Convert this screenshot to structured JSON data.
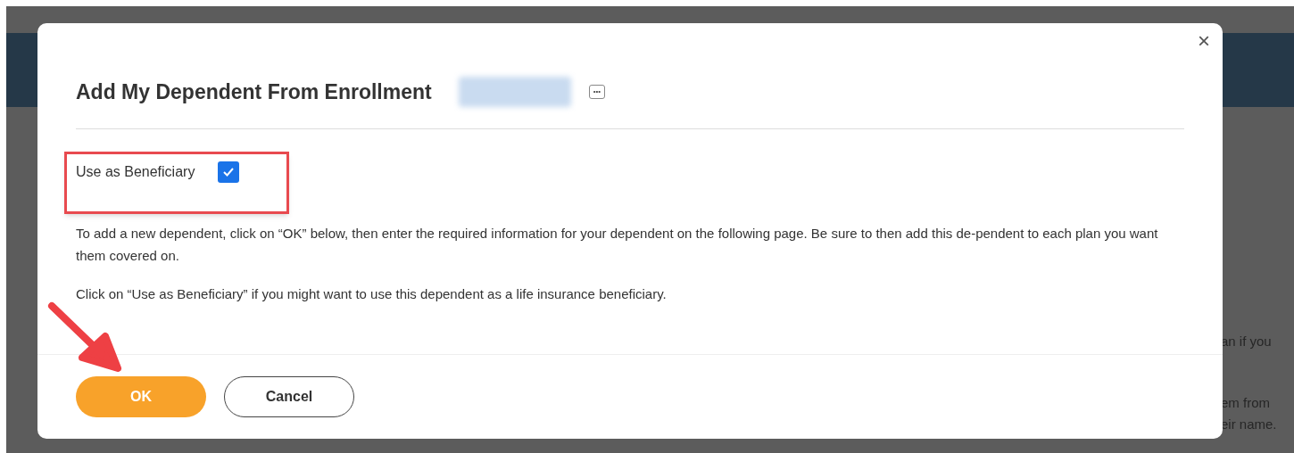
{
  "background": {
    "fragments": [
      "an if you",
      "em from",
      "eir name."
    ]
  },
  "dialog": {
    "title": "Add My Dependent From Enrollment",
    "close": "×",
    "more": "•••",
    "checkbox": {
      "label": "Use as Beneficiary",
      "checked": true
    },
    "paragraphs": [
      "To add a new dependent, click on “OK” below, then enter the required information for your dependent on the following page. Be sure to then add this de-pendent to each plan you want them covered on.",
      "Click on “Use as Beneficiary” if you might want to use this dependent as a life insurance beneficiary."
    ],
    "buttons": [
      {
        "label": "OK",
        "kind": "primary"
      },
      {
        "label": "Cancel",
        "kind": "secondary"
      }
    ]
  }
}
